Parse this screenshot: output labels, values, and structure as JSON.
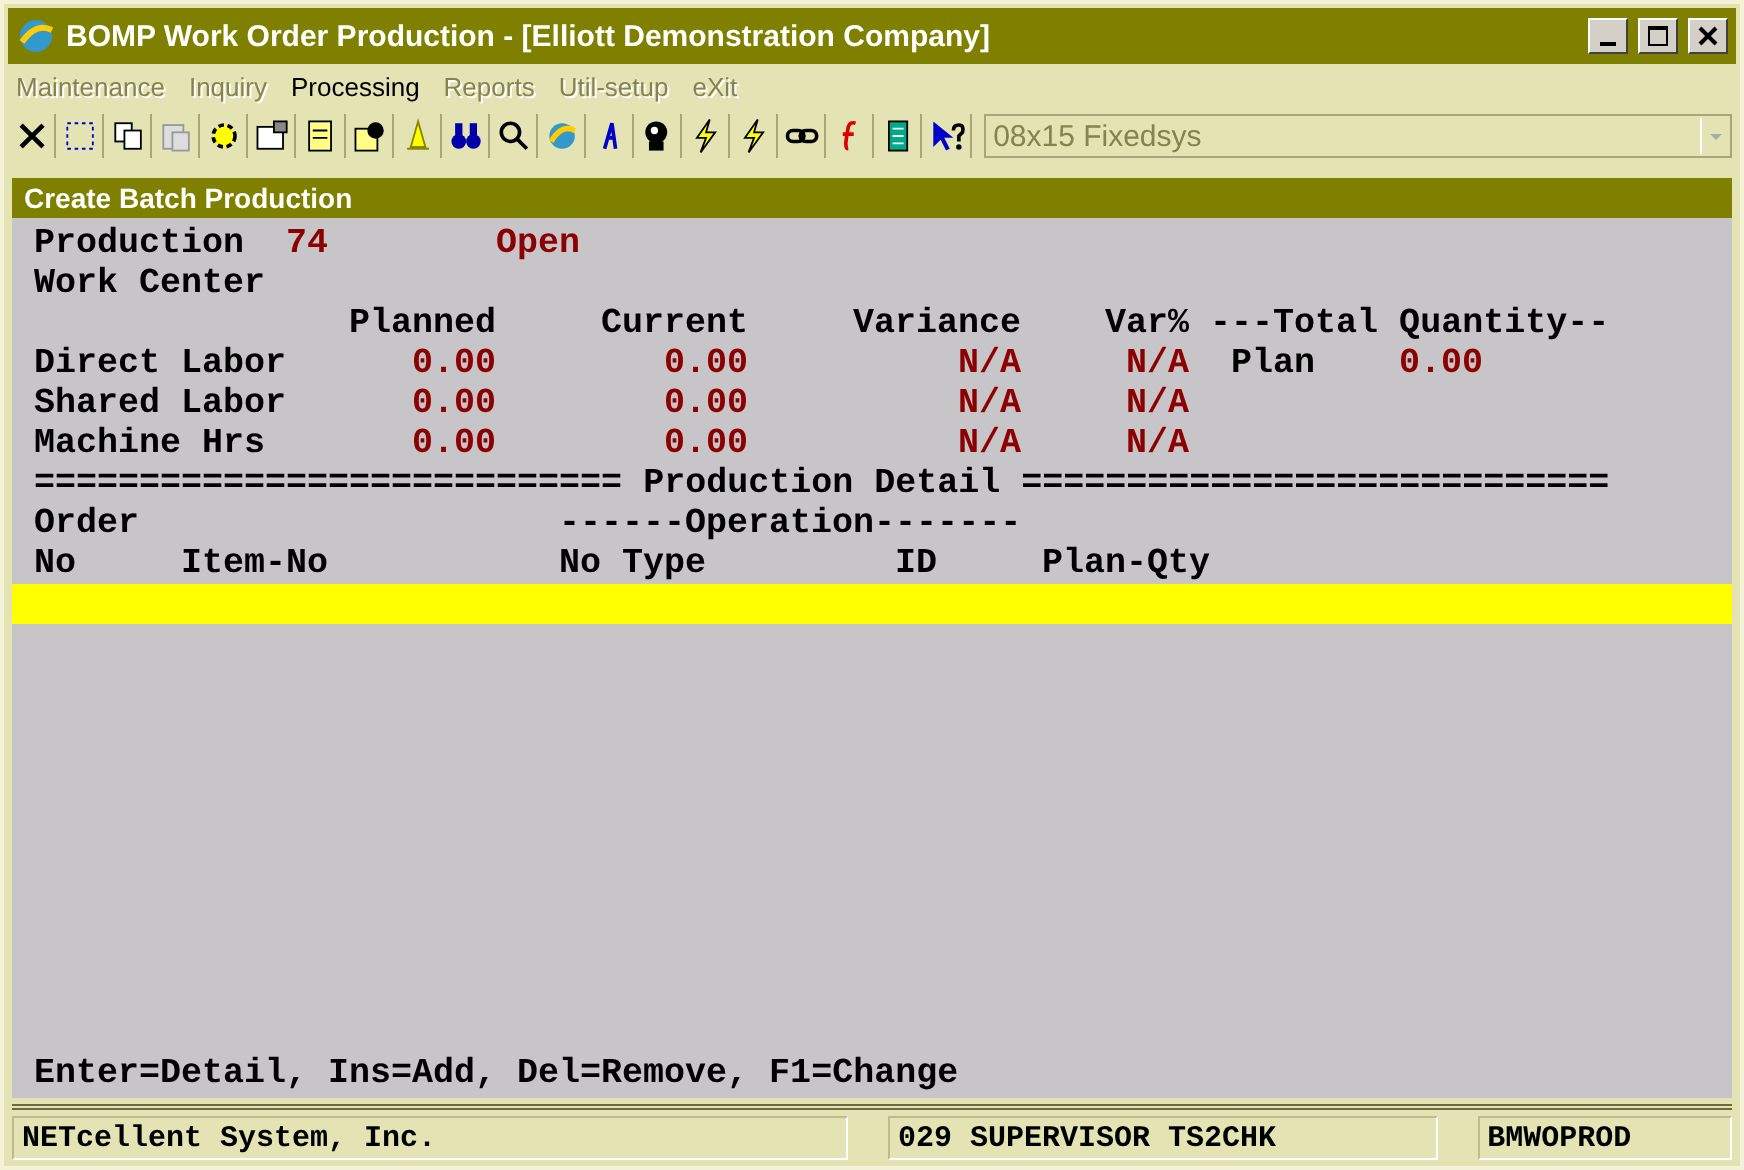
{
  "window": {
    "title": "BOMP Work Order Production - [Elliott Demonstration Company]"
  },
  "menu": [
    {
      "label": "Maintenance",
      "disabled": true
    },
    {
      "label": "Inquiry",
      "disabled": true
    },
    {
      "label": "Processing",
      "disabled": false
    },
    {
      "label": "Reports",
      "disabled": true
    },
    {
      "label": "Util-setup",
      "disabled": true
    },
    {
      "label": "eXit",
      "disabled": true
    }
  ],
  "toolbar": {
    "font_select": {
      "value": "08x15 Fixedsys",
      "disabled": true
    }
  },
  "panel": {
    "title": "Create Batch Production"
  },
  "header": {
    "production_label": "Production",
    "production_no": "74",
    "status": "Open",
    "work_center_label": "Work Center"
  },
  "summary": {
    "columns": [
      "Planned",
      "Current",
      "Variance",
      "Var%"
    ],
    "total_quantity_label": "---Total Quantity--",
    "plan_label": "Plan",
    "plan_value": "0.00",
    "rows": [
      {
        "label": "Direct Labor",
        "planned": "0.00",
        "current": "0.00",
        "variance": "N/A",
        "var_pct": "N/A"
      },
      {
        "label": "Shared Labor",
        "planned": "0.00",
        "current": "0.00",
        "variance": "N/A",
        "var_pct": "N/A"
      },
      {
        "label": "Machine Hrs",
        "planned": "0.00",
        "current": "0.00",
        "variance": "N/A",
        "var_pct": "N/A"
      }
    ]
  },
  "detail": {
    "divider_left": "============================",
    "title": "Production Detail",
    "divider_right": "============================",
    "group_order": "Order",
    "group_operation": "------Operation-------",
    "columns": [
      "No",
      "Item-No",
      "No",
      "Type",
      "ID",
      "Plan-Qty"
    ],
    "rows": [
      {
        "selected": true
      }
    ]
  },
  "hint": "Enter=Detail, Ins=Add, Del=Remove, F1=Change",
  "status_bar": [
    "NETcellent System, Inc.",
    "029 SUPERVISOR TS2CHK",
    "BMWOPROD"
  ]
}
